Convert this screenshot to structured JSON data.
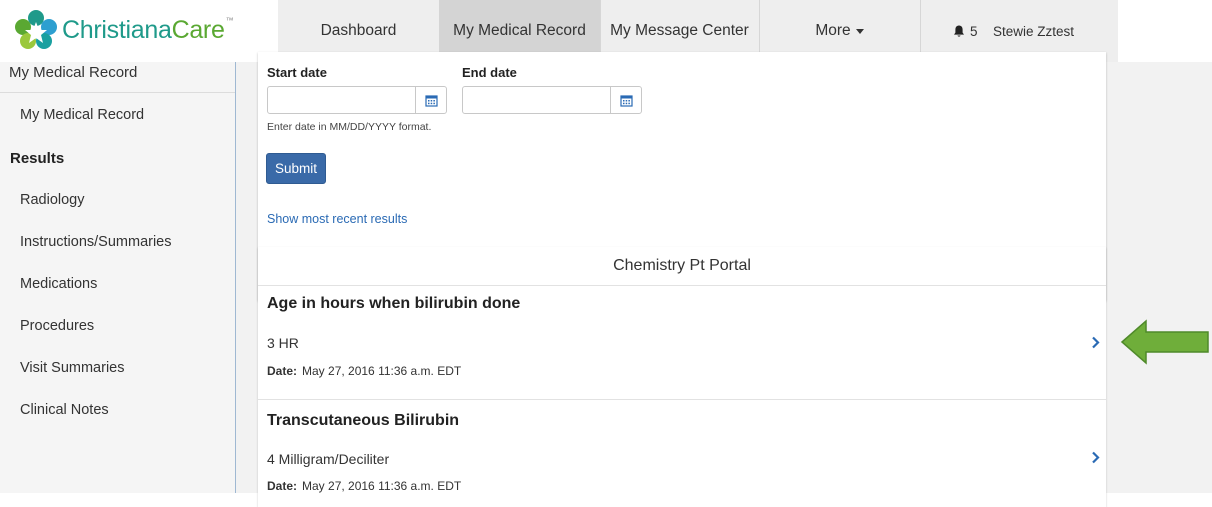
{
  "brand": {
    "name_part1": "Christiana",
    "name_part2": "Care",
    "tm": "™",
    "color_teal": "#1f9a8a",
    "color_green": "#5aa832"
  },
  "nav": {
    "items": [
      {
        "label": "Dashboard"
      },
      {
        "label": "My Medical Record",
        "active": true
      },
      {
        "label": "My Message Center"
      },
      {
        "label": "More"
      }
    ],
    "notification_count": "5",
    "user_name": "Stewie Zztest"
  },
  "sidebar": {
    "header": "My Medical Record",
    "items": [
      {
        "label": "My Medical Record"
      },
      {
        "label": "Results",
        "group": true
      },
      {
        "label": "Radiology"
      },
      {
        "label": "Instructions/Summaries"
      },
      {
        "label": "Medications"
      },
      {
        "label": "Procedures"
      },
      {
        "label": "Visit Summaries"
      },
      {
        "label": "Clinical Notes"
      }
    ]
  },
  "filter": {
    "start_label": "Start date",
    "end_label": "End date",
    "start_value": "",
    "end_value": "",
    "hint": "Enter date in MM/DD/YYYY format.",
    "submit_label": "Submit",
    "recent_link": "Show most recent results"
  },
  "results": {
    "title": "Chemistry Pt Portal",
    "date_label": "Date:",
    "items": [
      {
        "name": "Age in hours when bilirubin done",
        "value": "3 HR",
        "date": "May 27, 2016 11:36 a.m. EDT"
      },
      {
        "name": "Transcutaneous Bilirubin",
        "value": "4 Milligram/Deciliter",
        "date": "May 27, 2016 11:36 a.m. EDT"
      }
    ]
  },
  "colors": {
    "accent_blue": "#3a6aa8",
    "link_blue": "#2a6ab4",
    "arrow_green": "#6fae3a"
  }
}
